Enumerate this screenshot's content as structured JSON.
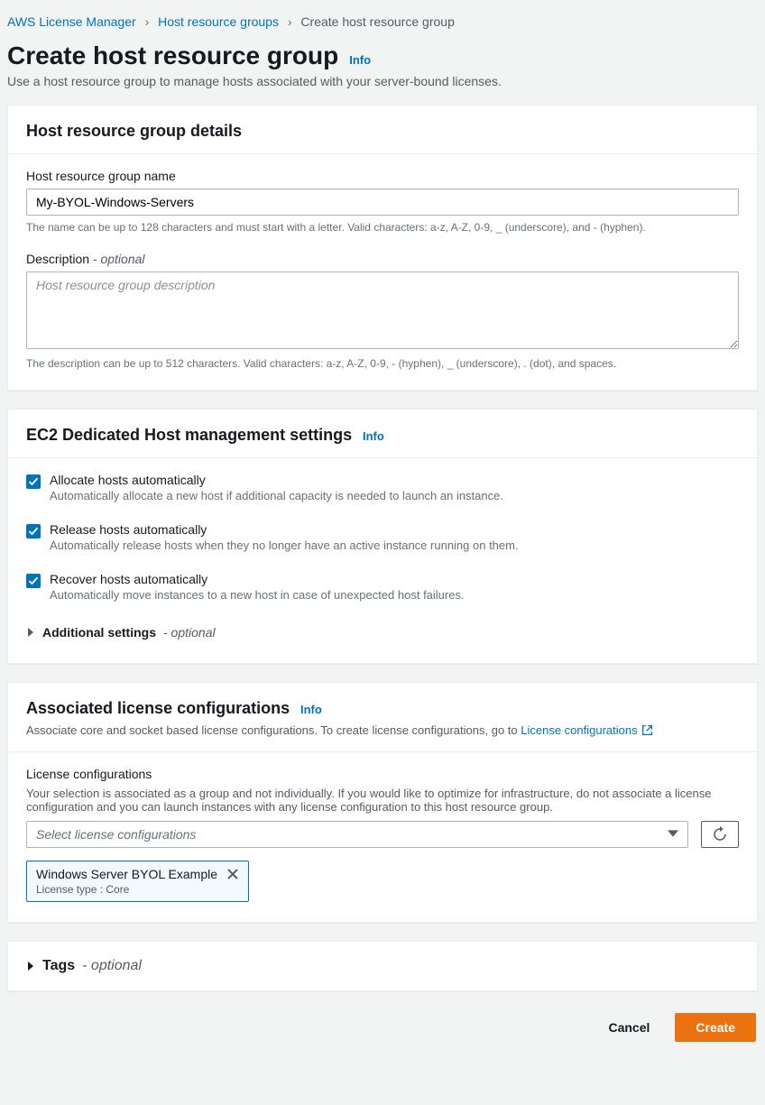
{
  "breadcrumb": {
    "root": "AWS License Manager",
    "mid": "Host resource groups",
    "current": "Create host resource group"
  },
  "page": {
    "title": "Create host resource group",
    "info": "Info",
    "description": "Use a host resource group to manage hosts associated with your server-bound licenses."
  },
  "details": {
    "header": "Host resource group details",
    "name_label": "Host resource group name",
    "name_value": "My-BYOL-Windows-Servers",
    "name_hint": "The name can be up to 128 characters and must start with a letter. Valid characters: a-z, A-Z, 0-9, _ (underscore), and - (hyphen).",
    "desc_label": "Description",
    "desc_optional": " - optional",
    "desc_placeholder": "Host resource group description",
    "desc_hint": "The description can be up to 512 characters. Valid characters: a-z, A-Z, 0-9, - (hyphen), _ (underscore), . (dot), and spaces."
  },
  "ec2": {
    "header": "EC2 Dedicated Host management settings",
    "info": "Info",
    "checks": [
      {
        "label": "Allocate hosts automatically",
        "desc": "Automatically allocate a new host if additional capacity is needed to launch an instance."
      },
      {
        "label": "Release hosts automatically",
        "desc": "Automatically release hosts when they no longer have an active instance running on them."
      },
      {
        "label": "Recover hosts automatically",
        "desc": "Automatically move instances to a new host in case of unexpected host failures."
      }
    ],
    "additional": "Additional settings",
    "additional_optional": " - optional"
  },
  "assoc": {
    "header": "Associated license configurations",
    "info": "Info",
    "desc_prefix": "Associate core and socket based license configurations. To create license configurations, go to ",
    "desc_link": "License configurations",
    "lc_label": "License configurations",
    "lc_hint": "Your selection is associated as a group and not individually. If you would like to optimize for infrastructure, do not associate a license configuration and you can launch instances with any license configuration to this host resource group.",
    "select_placeholder": "Select license configurations",
    "token_title": "Windows Server BYOL Example",
    "token_sub": "License type : Core"
  },
  "tags": {
    "label": "Tags",
    "optional": " - optional"
  },
  "footer": {
    "cancel": "Cancel",
    "create": "Create"
  }
}
